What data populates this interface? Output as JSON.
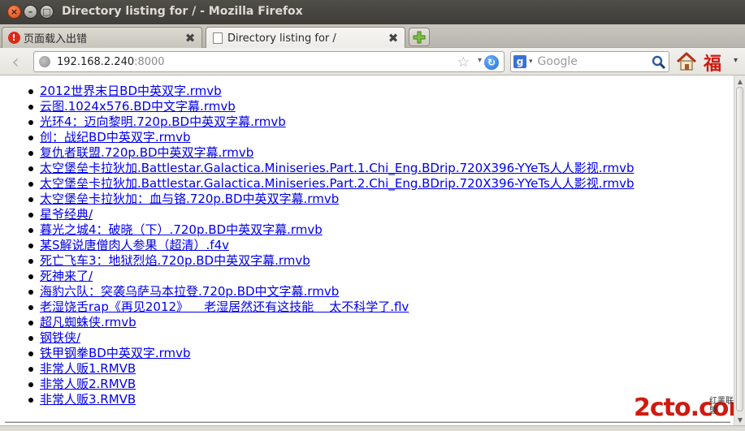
{
  "window": {
    "title": "Directory listing for / - Mozilla Firefox"
  },
  "tabs": [
    {
      "label": "页面载入出错",
      "icon": "error-icon",
      "active": false
    },
    {
      "label": "Directory listing for /",
      "icon": "page-icon",
      "active": true
    }
  ],
  "navbar": {
    "url_host": "192.168.2.240",
    "url_port": ":8000",
    "search_placeholder": "Google",
    "search_engine_letter": "g",
    "addon_glyph": "福"
  },
  "listing": [
    "2012世界末日BD中英双字.rmvb",
    "云图.1024x576.BD中文字幕.rmvb",
    "光环4：迈向黎明.720p.BD中英双字幕.rmvb",
    "创：战纪BD中英双字.rmvb",
    "复仇者联盟.720p.BD中英双字幕.rmvb",
    "太空堡垒卡拉狄加.Battlestar.Galactica.Miniseries.Part.1.Chi_Eng.BDrip.720X396-YYeTs人人影视.rmvb",
    "太空堡垒卡拉狄加.Battlestar.Galactica.Miniseries.Part.2.Chi_Eng.BDrip.720X396-YYeTs人人影视.rmvb",
    "太空堡垒卡拉狄加：血与铬.720p.BD中英双字幕.rmvb",
    "星爷经典/",
    "暮光之城4：破晓（下）.720p.BD中英双字幕.rmvb",
    "某S解说唐僧肉人参果（超清）.f4v",
    "死亡飞车3：地狱烈焰.720p.BD中英双字幕.rmvb",
    "死神来了/",
    "海豹六队：突袭乌萨马本拉登.720p.BD中文字幕.rmvb",
    "老湿饶舌rap《再见2012》    老湿居然还有这技能    太不科学了.flv",
    "超凡蜘蛛侠.rmvb",
    "钢铁侠/",
    "铁甲钢拳BD中英双字.rmvb",
    "非常人贩1.RMVB",
    "非常人贩2.RMVB",
    "非常人贩3.RMVB"
  ],
  "watermark": {
    "main": "2cto.com",
    "side_line1": "红黑联盟"
  },
  "colors": {
    "link": "#0000ee",
    "titlebar": "#3c3b37",
    "watermark": "#d01a10"
  }
}
